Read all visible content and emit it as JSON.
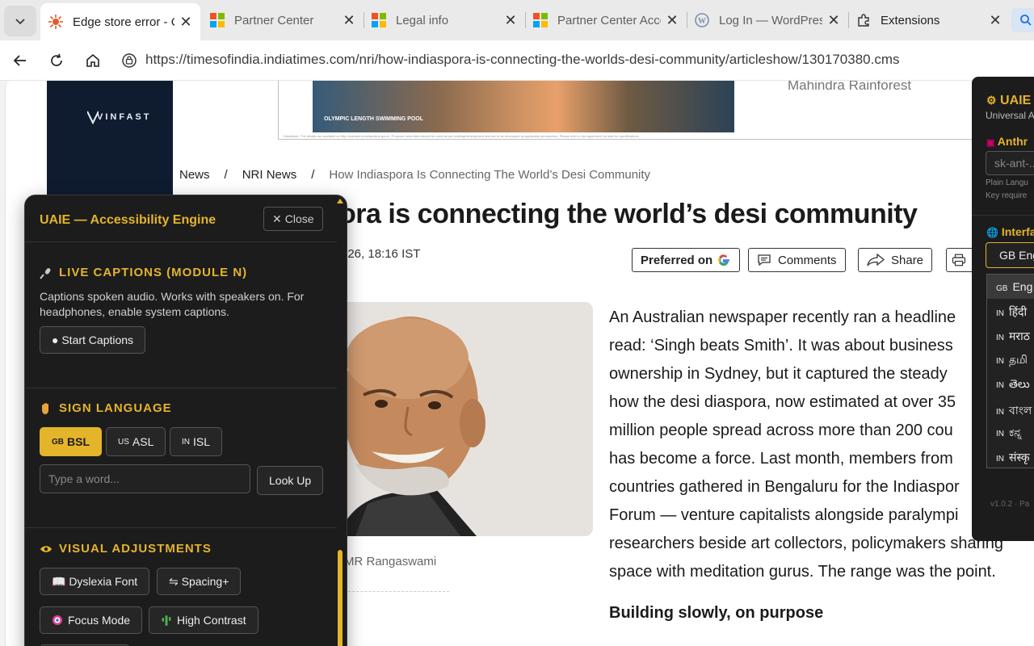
{
  "browser": {
    "tabs": [
      {
        "title": "Edge store error - C",
        "active": true
      },
      {
        "title": "Partner Center",
        "active": false
      },
      {
        "title": "Legal info",
        "active": false
      },
      {
        "title": "Partner Center Acco",
        "active": false
      },
      {
        "title": "Log In — WordPres",
        "active": false
      },
      {
        "title": "Extensions",
        "active": false
      }
    ],
    "url": "https://timesofindia.indiatimes.com/nri/how-indiaspora-is-connecting-the-worlds-desi-community/articleshow/130170380.cms"
  },
  "ads": {
    "vinfast_logo": "VINFAST",
    "banner_caption": "OLYMPIC LENGTH SWIMMING POOL",
    "banner_fine_print": "Disclaimer: The details are available on http://maharera.mahaonline.gov.in. Proposed amenities should be used as per building/development and are to be developed by applicable permissions. Please refer to the agreement for sale for specifications.",
    "right_text": "Mahindra Rainforest"
  },
  "breadcrumb": {
    "items": [
      "News",
      "NRI News",
      "How Indiaspora Is Connecting The World’s Desi Community"
    ],
    "separator": "/"
  },
  "article": {
    "headline_visible": "ora is connecting the world’s desi community",
    "dateline_visible": "026, 18:16 IST",
    "actions": {
      "preferred": "Preferred on",
      "comments": "Comments",
      "share": "Share"
    },
    "photo_caption": "MR Rangaswami",
    "paragraph_lines": [
      "An Australian newspaper recently ran a headline",
      "read: ‘Singh beats Smith’. It was about business",
      "ownership in Sydney, but it captured the steady",
      "how the desi diaspora, now estimated at over 35",
      "million people spread across more than 200 cou",
      "has become a force. Last month, members from",
      "countries gathered in Bengaluru for the Indiaspor",
      "Forum — venture capitalists alongside paralympi",
      "researchers beside art collectors, policymakers sharing",
      "space with meditation gurus. The range was the point."
    ],
    "subhead": "Building slowly, on purpose"
  },
  "uaie_panel": {
    "title": "UAIE — Accessibility Engine",
    "close_label": "Close",
    "captions": {
      "title": "LIVE CAPTIONS (MODULE N)",
      "description": "Captions spoken audio. Works with speakers on. For headphones, enable system captions.",
      "start_label": "● Start Captions"
    },
    "sign_language": {
      "title": "SIGN LANGUAGE",
      "options": [
        {
          "flag": "GB",
          "label": "BSL",
          "selected": true
        },
        {
          "flag": "US",
          "label": "ASL",
          "selected": false
        },
        {
          "flag": "IN",
          "label": "ISL",
          "selected": false
        }
      ],
      "word_placeholder": "Type a word...",
      "lookup_label": "Look Up"
    },
    "visual": {
      "title": "VISUAL ADJUSTMENTS",
      "buttons": [
        "📖 Dyslexia Font",
        "⇋ Spacing+",
        "Focus Mode",
        "High Contrast"
      ]
    }
  },
  "uaie_side": {
    "title": "UAIE",
    "subtitle": "Universal A",
    "anthropic_label": "Anthr",
    "key_placeholder": "sk-ant-...",
    "key_hint_1": "Plain Langu",
    "key_hint_2": "Key require",
    "interface_label": "Interfa",
    "selected_language": "GB Eng",
    "languages": [
      {
        "flag": "GB",
        "label": "Eng",
        "selected": true
      },
      {
        "flag": "IN",
        "label": "हिंदी",
        "selected": false
      },
      {
        "flag": "IN",
        "label": "मराठ",
        "selected": false
      },
      {
        "flag": "IN",
        "label": "தமி",
        "selected": false
      },
      {
        "flag": "IN",
        "label": "తెలు",
        "selected": false
      },
      {
        "flag": "IN",
        "label": "বাংল",
        "selected": false
      },
      {
        "flag": "IN",
        "label": "ಕನ್ನ",
        "selected": false
      },
      {
        "flag": "IN",
        "label": "संस्कृ",
        "selected": false
      }
    ],
    "version": "v1.0.2 · Pa"
  },
  "colors": {
    "accent_gold": "#e4b42b",
    "panel_bg": "#1c1c1c",
    "chrome_bg": "#eaeaea"
  }
}
